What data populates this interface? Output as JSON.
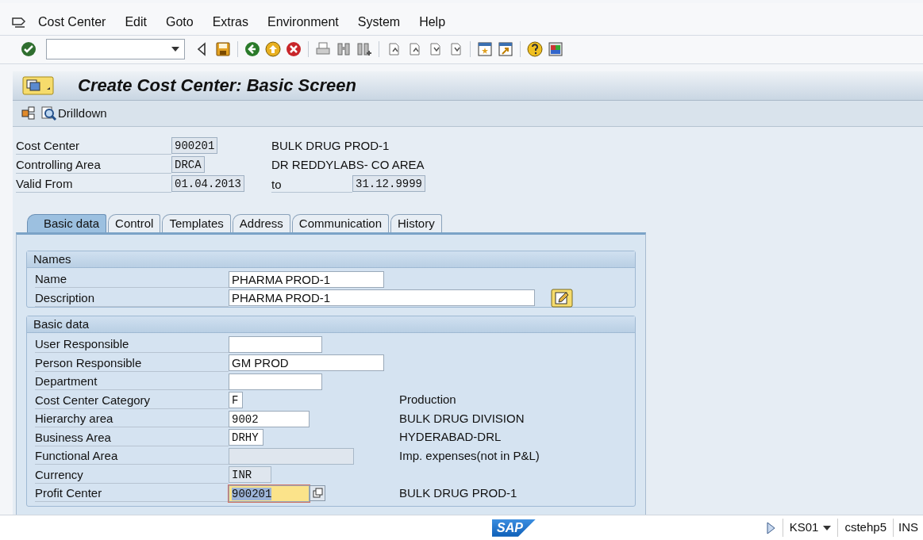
{
  "menu_bar": [
    "Cost Center",
    "Edit",
    "Goto",
    "Extras",
    "Environment",
    "System",
    "Help"
  ],
  "title": "Create Cost Center: Basic Screen",
  "app_toolbar": {
    "drilldown": "Drilldown"
  },
  "header_fields": [
    {
      "label": "Cost Center",
      "value": "900201",
      "editable": false,
      "description": "BULK DRUG PROD-1"
    },
    {
      "label": "Controlling Area",
      "value": "DRCA",
      "editable": false,
      "description": "DR REDDYLABS- CO AREA"
    },
    {
      "label": "Valid From",
      "value": "01.04.2013",
      "editable": false,
      "to_label": "to",
      "to_value": "31.12.9999"
    }
  ],
  "tabs": [
    {
      "label": "Basic data",
      "selected": true
    },
    {
      "label": "Control",
      "selected": false
    },
    {
      "label": "Templates",
      "selected": false
    },
    {
      "label": "Address",
      "selected": false
    },
    {
      "label": "Communication",
      "selected": false
    },
    {
      "label": "History",
      "selected": false
    }
  ],
  "groups": [
    {
      "title": "Names",
      "fields": [
        {
          "label": "Name",
          "value": "PHARMA PROD-1",
          "editable": true,
          "focused": false
        },
        {
          "label": "Description",
          "value": "PHARMA PROD-1",
          "editable": true,
          "focused": false
        }
      ]
    },
    {
      "title": "Basic data",
      "fields": [
        {
          "label": "User Responsible",
          "editable": true,
          "focused": false
        },
        {
          "label": "Person Responsible",
          "value": "GM PROD",
          "editable": true,
          "focused": false
        },
        {
          "label": "Department",
          "editable": true,
          "focused": false
        },
        {
          "label": "Cost Center Category",
          "value": "F",
          "editable": true,
          "focused": false,
          "description": "Production"
        },
        {
          "label": "Hierarchy area",
          "value": "9002",
          "editable": true,
          "focused": false,
          "description": "BULK DRUG DIVISION"
        },
        {
          "label": "Business Area",
          "value": "DRHY",
          "editable": true,
          "focused": false,
          "description": "HYDERABAD-DRL"
        },
        {
          "label": "Functional Area",
          "editable": false,
          "focused": false,
          "description": "Imp. expenses(not in P&L)"
        },
        {
          "label": "Currency",
          "value": "INR",
          "editable": false,
          "focused": false
        },
        {
          "label": "Profit Center",
          "value": "900201",
          "editable": true,
          "focused": true,
          "description": "BULK DRUG PROD-1"
        }
      ]
    }
  ],
  "status_bar": {
    "logo": "SAP",
    "transaction": "KS01",
    "server": "cstehp5",
    "mode": "INS"
  }
}
